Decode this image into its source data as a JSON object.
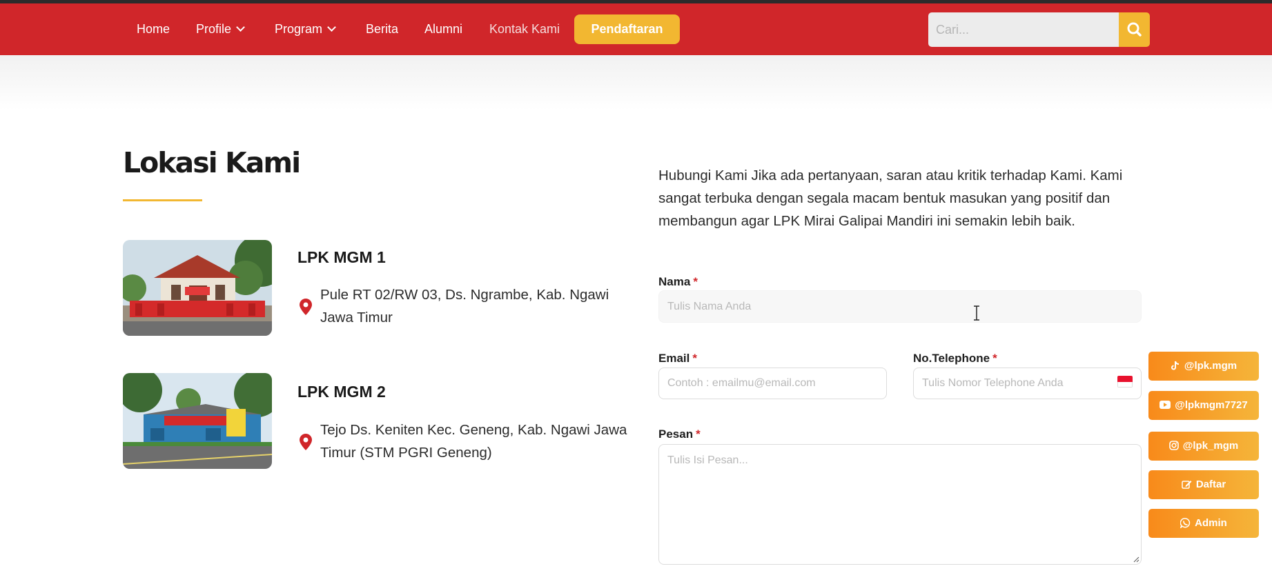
{
  "nav": {
    "items": [
      {
        "label": "Home",
        "has_dropdown": false
      },
      {
        "label": "Profile",
        "has_dropdown": true
      },
      {
        "label": "Program",
        "has_dropdown": true
      },
      {
        "label": "Berita",
        "has_dropdown": false
      },
      {
        "label": "Alumni",
        "has_dropdown": false
      },
      {
        "label": "Kontak Kami",
        "has_dropdown": false,
        "active": true
      }
    ],
    "cta_label": "Pendaftaran",
    "search_placeholder": "Cari...",
    "search_icon": "search-icon"
  },
  "locations": {
    "heading": "Lokasi Kami",
    "items": [
      {
        "title": "LPK MGM 1",
        "address": "Pule RT 02/RW 03, Ds. Ngrambe, Kab. Ngawi Jawa Timur",
        "icon": "map-pin-icon"
      },
      {
        "title": "LPK MGM 2",
        "address": "Tejo Ds. Keniten Kec. Geneng, Kab. Ngawi Jawa Timur (STM PGRI Geneng)",
        "icon": "map-pin-icon"
      }
    ]
  },
  "contact": {
    "intro": "Hubungi Kami Jika ada pertanyaan, saran atau kritik terhadap Kami. Kami sangat terbuka dengan segala macam bentuk masukan yang positif dan membangun agar LPK Mirai Galipai Mandiri ini semakin lebih baik.",
    "required_mark": "*",
    "fields": {
      "name": {
        "label": "Nama",
        "placeholder": "Tulis Nama Anda"
      },
      "email": {
        "label": "Email",
        "placeholder": "Contoh : emailmu@email.com"
      },
      "phone": {
        "label": "No.Telephone",
        "placeholder": "Tulis Nomor Telephone Anda",
        "flag_icon": "indonesia-flag-icon"
      },
      "message": {
        "label": "Pesan",
        "placeholder": "Tulis Isi Pesan..."
      }
    }
  },
  "social": [
    {
      "label": "@lpk.mgm",
      "icon": "tiktok-icon"
    },
    {
      "label": "@lpkmgm7727",
      "icon": "youtube-icon"
    },
    {
      "label": "@lpk_mgm",
      "icon": "instagram-icon"
    },
    {
      "label": "Daftar",
      "icon": "edit-icon"
    },
    {
      "label": "Admin",
      "icon": "whatsapp-icon"
    }
  ],
  "colors": {
    "brand_red": "#d0262a",
    "accent_yellow": "#f2b731",
    "social_orange": "#f88a1a"
  }
}
